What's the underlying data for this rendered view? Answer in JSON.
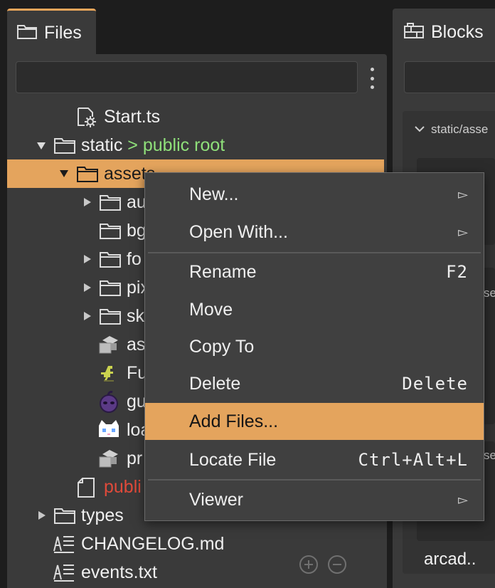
{
  "files_panel": {
    "tab_label": "Files",
    "tree": [
      {
        "label": "Start.ts",
        "icon": "gear-file-icon"
      },
      {
        "label": "static",
        "suffix": " > public root",
        "icon": "folder-icon",
        "expanded": true
      },
      {
        "label": "assets",
        "icon": "folder-icon",
        "expanded": true,
        "selected": true
      },
      {
        "label": "au",
        "icon": "folder-icon"
      },
      {
        "label": "bg",
        "icon": "folder-icon"
      },
      {
        "label": "fo",
        "icon": "folder-icon"
      },
      {
        "label": "pix",
        "icon": "folder-icon"
      },
      {
        "label": "sk",
        "icon": "folder-icon"
      },
      {
        "label": "as",
        "icon": "asset-stack-icon"
      },
      {
        "label": "Fu",
        "icon": "dino-sprite-icon"
      },
      {
        "label": "gu",
        "icon": "purple-orb-icon"
      },
      {
        "label": "loa",
        "icon": "cat-face-icon"
      },
      {
        "label": "pr",
        "icon": "asset-stack-icon"
      },
      {
        "label": "publi",
        "icon": "page-icon",
        "color": "#e04a3a"
      },
      {
        "label": "types",
        "icon": "folder-icon"
      },
      {
        "label": "CHANGELOG.md",
        "icon": "text-file-icon"
      },
      {
        "label": "events.txt",
        "icon": "text-file-icon"
      }
    ]
  },
  "blocks_panel": {
    "tab_label": "Blocks",
    "section_label": "static/asse",
    "card_label": "arcad..",
    "fragments": [
      "se",
      "se"
    ]
  },
  "context_menu": {
    "items": [
      {
        "label": "New...",
        "shortcut": "",
        "submenu": true
      },
      {
        "label": "Open With...",
        "shortcut": "",
        "submenu": true
      },
      {
        "label": "Rename",
        "shortcut": "F2",
        "submenu": false
      },
      {
        "label": "Move",
        "shortcut": "",
        "submenu": false
      },
      {
        "label": "Copy To",
        "shortcut": "",
        "submenu": false
      },
      {
        "label": "Delete",
        "shortcut": "Delete",
        "submenu": false
      },
      {
        "label": "Add Files...",
        "shortcut": "",
        "submenu": false,
        "highlighted": true
      },
      {
        "label": "Locate File",
        "shortcut": "Ctrl+Alt+L",
        "submenu": false
      },
      {
        "label": "Viewer",
        "shortcut": "",
        "submenu": true
      }
    ],
    "submenu_glyph": "▻"
  },
  "colors": {
    "accent": "#e4a45d",
    "panel": "#3a3a3a",
    "green_label": "#8fe07a",
    "error_label": "#e04a3a"
  }
}
